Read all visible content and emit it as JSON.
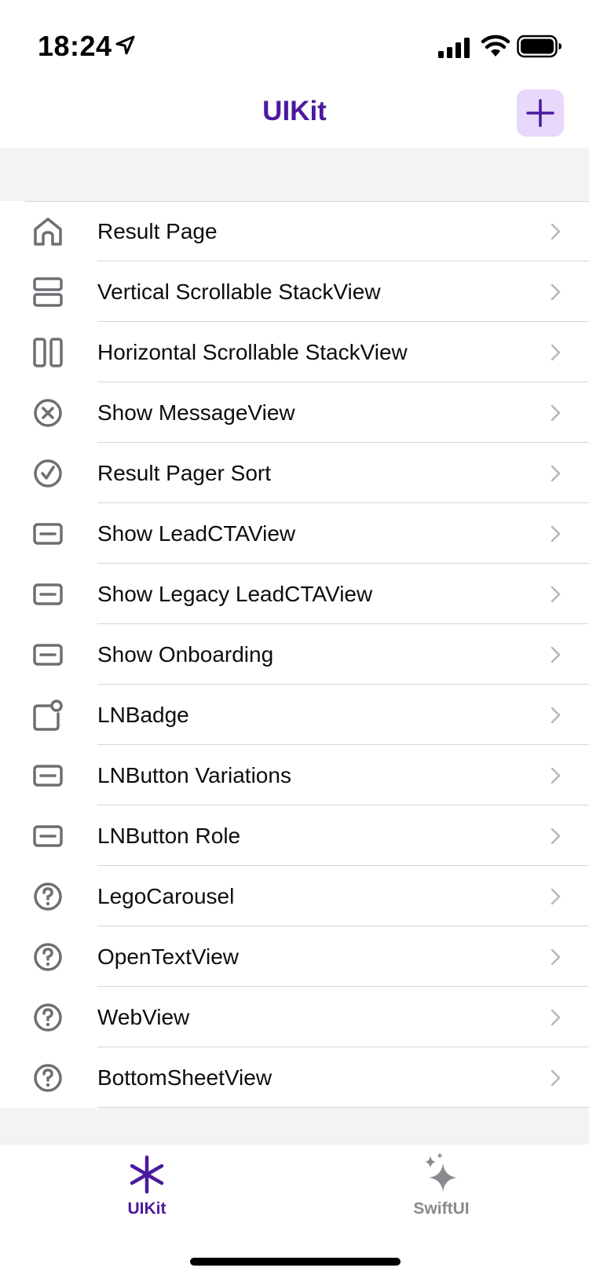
{
  "status_bar": {
    "time": "18:24",
    "icons": [
      "location-arrow-icon",
      "signal-icon",
      "wifi-icon",
      "battery-icon"
    ]
  },
  "nav": {
    "title": "UIKit",
    "add_button_icon": "plus-icon"
  },
  "colors": {
    "accent": "#4a1aa0",
    "accent_bg": "#e8d8fb",
    "icon_gray": "#6e6e73",
    "background": "#f2f3f3",
    "separator": "#d7d7d7"
  },
  "list": {
    "items": [
      {
        "label": "Result Page",
        "icon": "house-icon"
      },
      {
        "label": "Vertical Scrollable StackView",
        "icon": "rows-icon"
      },
      {
        "label": "Horizontal Scrollable StackView",
        "icon": "columns-icon"
      },
      {
        "label": "Show MessageView",
        "icon": "x-circle-icon"
      },
      {
        "label": "Result Pager Sort",
        "icon": "checkmark-circle-icon"
      },
      {
        "label": "Show LeadCTAView",
        "icon": "button-rect-icon"
      },
      {
        "label": "Show Legacy LeadCTAView",
        "icon": "button-rect-icon"
      },
      {
        "label": "Show Onboarding",
        "icon": "button-rect-icon"
      },
      {
        "label": "LNBadge",
        "icon": "badge-icon"
      },
      {
        "label": "LNButton Variations",
        "icon": "button-rect-icon"
      },
      {
        "label": "LNButton Role",
        "icon": "button-rect-icon"
      },
      {
        "label": "LegoCarousel",
        "icon": "question-circle-icon"
      },
      {
        "label": "OpenTextView",
        "icon": "question-circle-icon"
      },
      {
        "label": "WebView",
        "icon": "question-circle-icon"
      },
      {
        "label": "BottomSheetView",
        "icon": "question-circle-icon"
      }
    ]
  },
  "tab_bar": {
    "tabs": [
      {
        "label": "UIKit",
        "icon": "asterisk-icon",
        "selected": true
      },
      {
        "label": "SwiftUI",
        "icon": "sparkles-icon",
        "selected": false
      }
    ]
  }
}
